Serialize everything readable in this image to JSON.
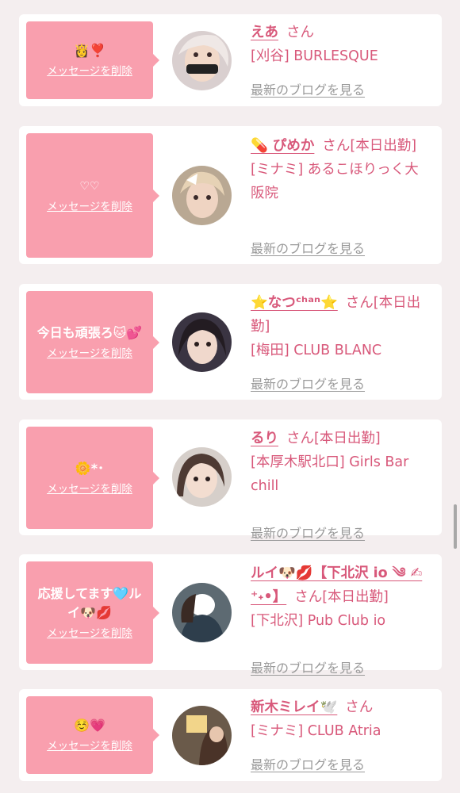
{
  "delete_label": "メッセージを削除",
  "blog_label": "最新のブログを見る",
  "cards": [
    {
      "message": "👸❣️",
      "name": "えあ",
      "san": "さん",
      "shop": "[刈谷] BURLESQUE"
    },
    {
      "message": "♡♡",
      "name": "💊 ぴめか",
      "san": "さん[本日出勤]",
      "shop": "[ミナミ] あるこほりっく大阪院"
    },
    {
      "message": "今日も頑張ろ🐱💕",
      "name": "⭐️なつᶜʰᵃⁿ⭐️",
      "san": "さん[本日出勤]",
      "shop": "[梅田] CLUB BLANC"
    },
    {
      "message": "🌼*･",
      "name": "るり",
      "san": "さん[本日出勤]",
      "shop": "[本厚木駅北口] Girls Bar chill"
    },
    {
      "message": "応援してます🩵ルイ🐶💋",
      "name": "ルイ🐶💋【下北沢 io ༄ ✍︎⁺˖•】",
      "san": "さん[本日出勤]",
      "shop": "[下北沢] Pub Club io"
    },
    {
      "message": "☺️💗",
      "name": "新木ミレイ🕊️",
      "san": "さん",
      "shop": "[ミナミ] CLUB Atria"
    }
  ],
  "colors": {
    "accent": "#d8587a",
    "bubble": "#f99fae",
    "link_gray": "#9a9a9a"
  }
}
